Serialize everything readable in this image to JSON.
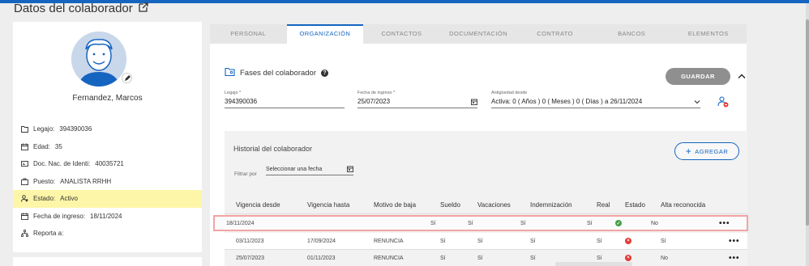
{
  "page": {
    "title": "Datos del colaborador"
  },
  "profile": {
    "name": "Fernandez, Marcos",
    "info": [
      {
        "icon": "folder-icon",
        "label": "Legajo:",
        "value": "394390036"
      },
      {
        "icon": "calendar-icon",
        "label": "Edad:",
        "value": "35"
      },
      {
        "icon": "id-card-icon",
        "label": "Doc. Nac. de Identi:",
        "value": "40035721"
      },
      {
        "icon": "briefcase-icon",
        "label": "Puesto:",
        "value": "ANALISTA RRHH"
      },
      {
        "icon": "person-status-icon",
        "label": "Estado:",
        "value": "Activo"
      },
      {
        "icon": "calendar-icon",
        "label": "Fecha de ingreso:",
        "value": "18/11/2024"
      },
      {
        "icon": "org-chart-icon",
        "label": "Reporta a:",
        "value": ""
      }
    ]
  },
  "tabs": [
    "PERSONAL",
    "ORGANIZACIÓN",
    "CONTACTOS",
    "DOCUMENTACIÓN",
    "CONTRATO",
    "BANCOS",
    "ELEMENTOS"
  ],
  "active_tab": "ORGANIZACIÓN",
  "section": {
    "title": "Fases del colaborador",
    "help": "?",
    "save_label": "GUARDAR"
  },
  "fields": {
    "legajo": {
      "label": "Legajo *",
      "value": "394390036"
    },
    "fecha_ingreso": {
      "label": "Fecha de ingreso *",
      "value": "25/07/2023"
    },
    "antiguedad": {
      "label": "Antigüedad desde",
      "value": "Activa: 0 ( Años ) 0 ( Meses ) 0 ( Días ) a 26/11/2024"
    }
  },
  "history": {
    "title": "Historial del colaborador",
    "add_label": "AGREGAR",
    "filter_label": "Filtrar por",
    "filter_placeholder": "Seleccionar una fecha",
    "columns": [
      "Vigencia desde",
      "Vigencia hasta",
      "Motivo de baja",
      "Sueldo",
      "Vacaciones",
      "Indemnización",
      "Real",
      "Estado",
      "Alta reconocida"
    ],
    "rows": [
      {
        "desde": "18/11/2024",
        "hasta": "",
        "motivo": "",
        "sueldo": "Sí",
        "vacaciones": "Sí",
        "indemnizacion": "Sí",
        "real": "Sí",
        "estado": "ok",
        "alta": "No"
      },
      {
        "desde": "03/11/2023",
        "hasta": "17/09/2024",
        "motivo": "RENUNCIA",
        "sueldo": "Sí",
        "vacaciones": "Sí",
        "indemnizacion": "Sí",
        "real": "Sí",
        "estado": "bad",
        "alta": "Sí"
      },
      {
        "desde": "25/07/2023",
        "hasta": "01/11/2023",
        "motivo": "RENUNCIA",
        "sueldo": "Sí",
        "vacaciones": "Sí",
        "indemnizacion": "Sí",
        "real": "Sí",
        "estado": "bad",
        "alta": "No"
      }
    ],
    "row_menu": "•••"
  },
  "colors": {
    "accent": "#1565c0",
    "ok": "#43a047",
    "error": "#e53935",
    "highlight": "#fdf6a8",
    "selected_border": "#f4a3a3"
  }
}
